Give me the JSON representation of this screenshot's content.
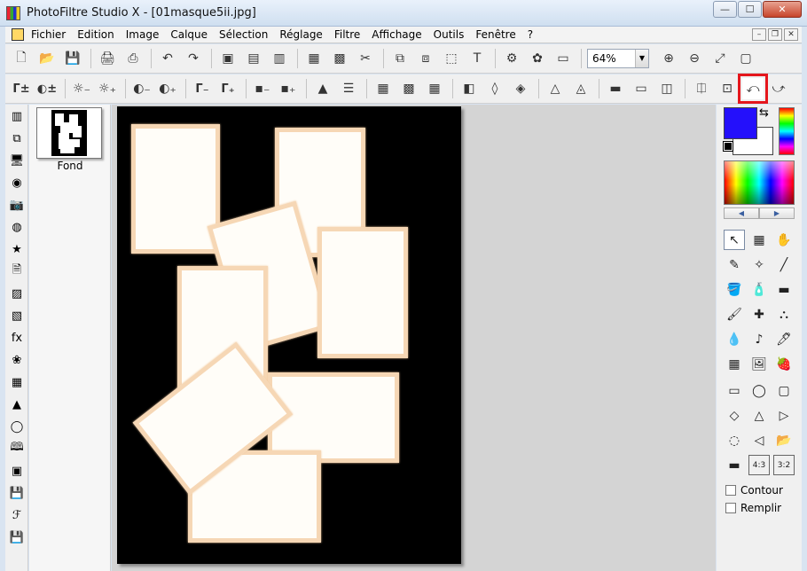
{
  "window": {
    "title": "PhotoFiltre Studio X - [01masque5ii.jpg]",
    "minimize": "—",
    "maximize": "☐",
    "close": "✕"
  },
  "menu": [
    "Fichier",
    "Edition",
    "Image",
    "Calque",
    "Sélection",
    "Réglage",
    "Filtre",
    "Affichage",
    "Outils",
    "Fenêtre",
    "?"
  ],
  "mdi": {
    "minimize": "–",
    "restore": "❐",
    "close": "✕"
  },
  "toolbar1": {
    "zoom_value": "64%",
    "zoom_drop": "▼",
    "icons": [
      "🗋",
      "📂",
      "💾",
      "🖨",
      "⎙",
      "↶",
      "↷",
      "▣",
      "▤",
      "▥",
      "▦",
      "▩",
      "✂",
      "⧉",
      "⧈",
      "⬚",
      "T",
      "⚙",
      "✿",
      "▭"
    ],
    "zoom_icons": [
      "⊕",
      "⊖",
      "⤢",
      "▢"
    ]
  },
  "toolbar2": {
    "icons": [
      "Γ±",
      "◐±",
      "☼₋",
      "☼₊",
      "◐₋",
      "◐₊",
      "Γ₋",
      "Γ₊",
      "▪₋",
      "▪₊",
      "▲",
      "☰",
      "▦",
      "▩",
      "▦",
      "◧",
      "◊",
      "◈",
      "△",
      "◬",
      "▬",
      "▭",
      "◫",
      "⎅",
      "⊡",
      "⤺",
      "⤻"
    ],
    "highlighted_index": 25
  },
  "left_tools": [
    "▥",
    "⧉",
    "🖥",
    "◉",
    "📷",
    "◍",
    "★",
    "🗎",
    "▨",
    "▧",
    "fx",
    "❀",
    "▦",
    "▲",
    "◯",
    "🕮",
    "▣",
    "💾",
    "ℱ",
    "💾"
  ],
  "layers": {
    "name": "Fond"
  },
  "colors": {
    "foreground": "#2410fb",
    "background": "#ffffff",
    "swap": "⇆",
    "left": "◀",
    "right": "▶"
  },
  "tools_top": [
    "↖",
    "▦",
    "✋",
    "✎",
    "✧",
    "╱",
    "🪣",
    "🧴",
    "▬",
    "🖌",
    "✚",
    "⛬",
    "💧",
    "♪",
    "🖊",
    "▦",
    "🖼",
    "🍓"
  ],
  "tools_shapes": [
    "▭",
    "◯",
    "▢",
    "◇",
    "△",
    "▷",
    "◌",
    "◁",
    "📂",
    "▬",
    "4:3",
    "3:2"
  ],
  "options": {
    "contour": "Contour",
    "remplir": "Remplir"
  }
}
